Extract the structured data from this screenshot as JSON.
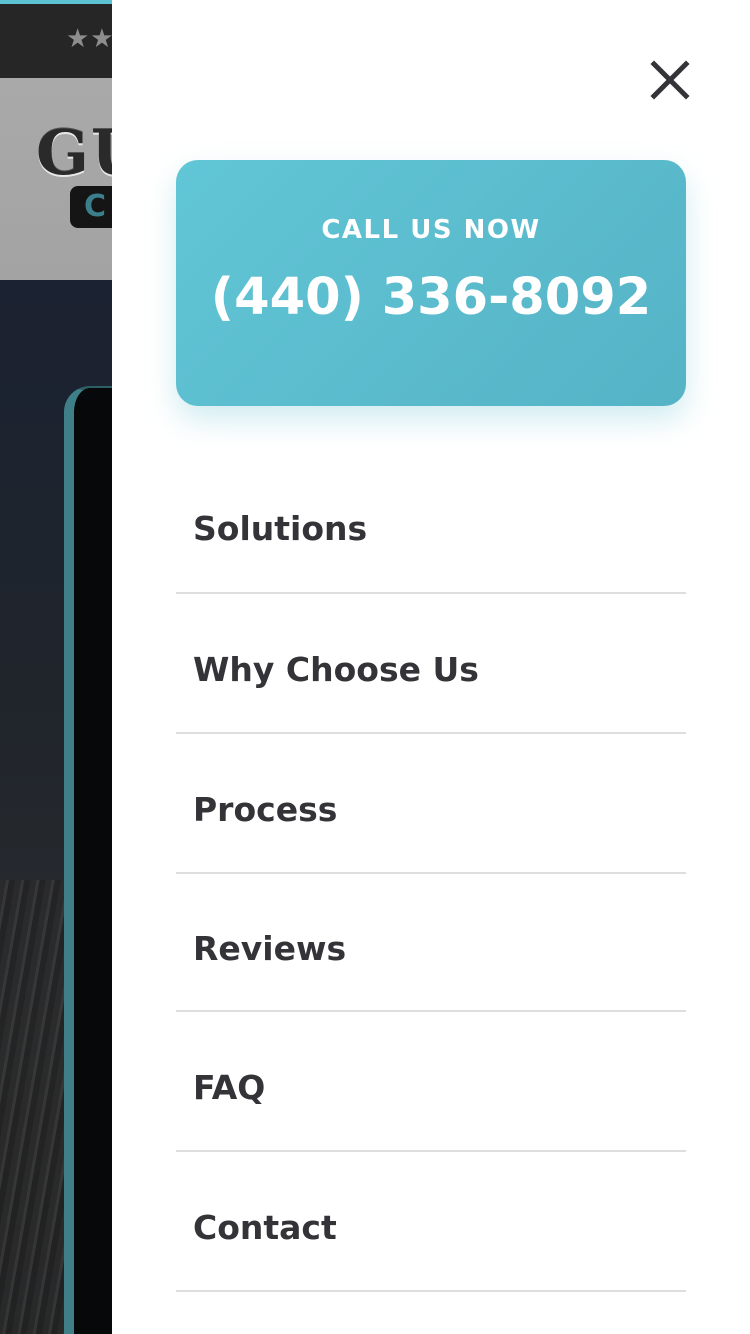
{
  "background": {
    "rating_stars": "★★",
    "logo_text": "GU",
    "logo_badge_text": "C"
  },
  "drawer": {
    "close_icon": "close-icon",
    "call": {
      "label": "CALL US NOW",
      "phone": "(440) 336-8092"
    },
    "menu": [
      {
        "label": "Solutions"
      },
      {
        "label": "Why Choose Us"
      },
      {
        "label": "Process"
      },
      {
        "label": "Reviews"
      },
      {
        "label": "FAQ"
      },
      {
        "label": "Contact"
      }
    ]
  },
  "colors": {
    "accent": "#5bc3d4",
    "menu_text": "#333338",
    "divider": "#dedede",
    "drawer_bg": "#ffffff"
  }
}
